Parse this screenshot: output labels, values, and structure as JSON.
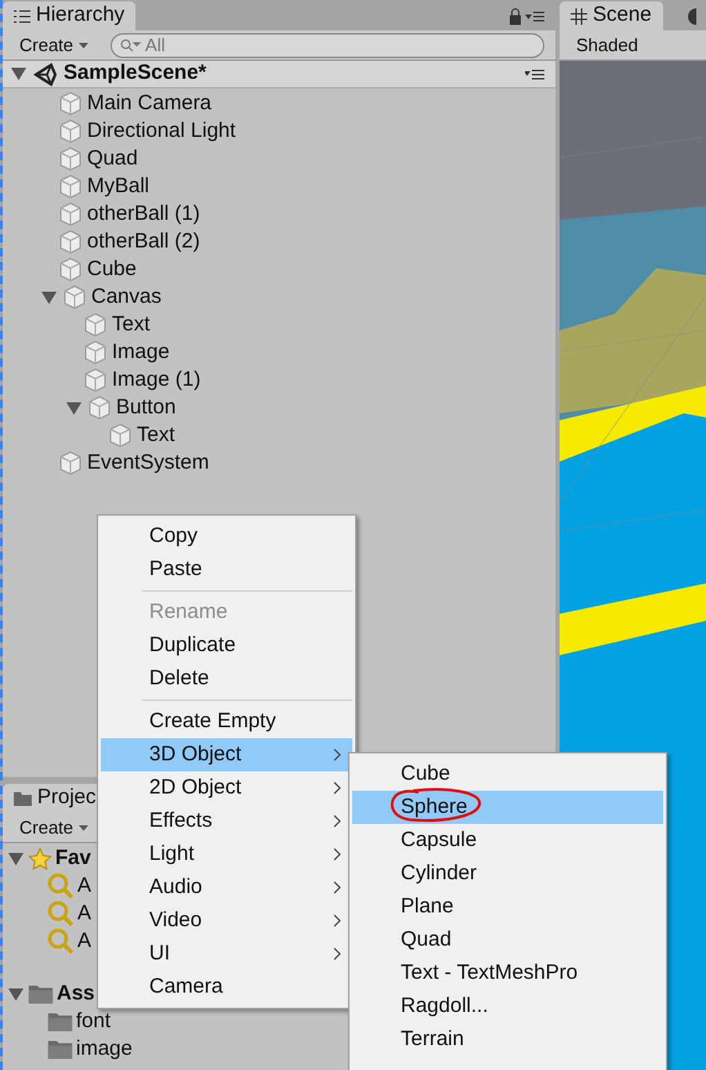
{
  "hierarchy": {
    "tab": "Hierarchy",
    "create": "Create",
    "search_placeholder": "All",
    "scene": {
      "name": "SampleScene*",
      "expanded": true
    },
    "items": [
      {
        "name": "Main Camera"
      },
      {
        "name": "Directional Light"
      },
      {
        "name": "Quad"
      },
      {
        "name": "MyBall"
      },
      {
        "name": "otherBall (1)"
      },
      {
        "name": "otherBall (2)"
      },
      {
        "name": "Cube"
      },
      {
        "name": "Canvas",
        "expanded": true,
        "children": [
          {
            "name": "Text"
          },
          {
            "name": "Image"
          },
          {
            "name": "Image (1)"
          },
          {
            "name": "Button",
            "expanded": true,
            "children": [
              {
                "name": "Text"
              }
            ]
          }
        ]
      },
      {
        "name": "EventSystem"
      }
    ]
  },
  "project": {
    "tab": "Projec",
    "create": "Create",
    "tree": [
      {
        "name": "Fav",
        "kind": "favorites",
        "expanded": true,
        "children": [
          {
            "name": "A",
            "kind": "search"
          },
          {
            "name": "A",
            "kind": "search"
          },
          {
            "name": "A",
            "kind": "search"
          }
        ]
      },
      {
        "name": "Ass",
        "kind": "folder",
        "expanded": true,
        "children": [
          {
            "name": "font",
            "kind": "folder"
          },
          {
            "name": "image",
            "kind": "folder"
          }
        ]
      }
    ]
  },
  "scene": {
    "tab": "Scene",
    "shading": "Shaded"
  },
  "context_menu": {
    "items": [
      {
        "kind": "item",
        "label": "Copy",
        "disabled": false,
        "selected": false,
        "submenu": false
      },
      {
        "kind": "item",
        "label": "Paste",
        "disabled": false,
        "selected": false,
        "submenu": false
      },
      {
        "kind": "separator"
      },
      {
        "kind": "item",
        "label": "Rename",
        "disabled": true,
        "selected": false,
        "submenu": false
      },
      {
        "kind": "item",
        "label": "Duplicate",
        "disabled": false,
        "selected": false,
        "submenu": false
      },
      {
        "kind": "item",
        "label": "Delete",
        "disabled": false,
        "selected": false,
        "submenu": false
      },
      {
        "kind": "separator"
      },
      {
        "kind": "item",
        "label": "Create Empty",
        "disabled": false,
        "selected": false,
        "submenu": false
      },
      {
        "kind": "item",
        "label": "3D Object",
        "disabled": false,
        "selected": true,
        "submenu": true
      },
      {
        "kind": "item",
        "label": "2D Object",
        "disabled": false,
        "selected": false,
        "submenu": true
      },
      {
        "kind": "item",
        "label": "Effects",
        "disabled": false,
        "selected": false,
        "submenu": true
      },
      {
        "kind": "item",
        "label": "Light",
        "disabled": false,
        "selected": false,
        "submenu": true
      },
      {
        "kind": "item",
        "label": "Audio",
        "disabled": false,
        "selected": false,
        "submenu": true
      },
      {
        "kind": "item",
        "label": "Video",
        "disabled": false,
        "selected": false,
        "submenu": true
      },
      {
        "kind": "item",
        "label": "UI",
        "disabled": false,
        "selected": false,
        "submenu": true
      },
      {
        "kind": "item",
        "label": "Camera",
        "disabled": false,
        "selected": false,
        "submenu": false
      }
    ]
  },
  "submenu": {
    "items": [
      {
        "label": "Cube",
        "selected": false,
        "circled": false
      },
      {
        "label": "Sphere",
        "selected": true,
        "circled": true
      },
      {
        "label": "Capsule",
        "selected": false,
        "circled": false
      },
      {
        "label": "Cylinder",
        "selected": false,
        "circled": false
      },
      {
        "label": "Plane",
        "selected": false,
        "circled": false
      },
      {
        "label": "Quad",
        "selected": false,
        "circled": false
      },
      {
        "label": "Text - TextMeshPro",
        "selected": false,
        "circled": false
      },
      {
        "label": "Ragdoll...",
        "selected": false,
        "circled": false
      },
      {
        "label": "Terrain",
        "selected": false,
        "circled": false
      }
    ]
  }
}
